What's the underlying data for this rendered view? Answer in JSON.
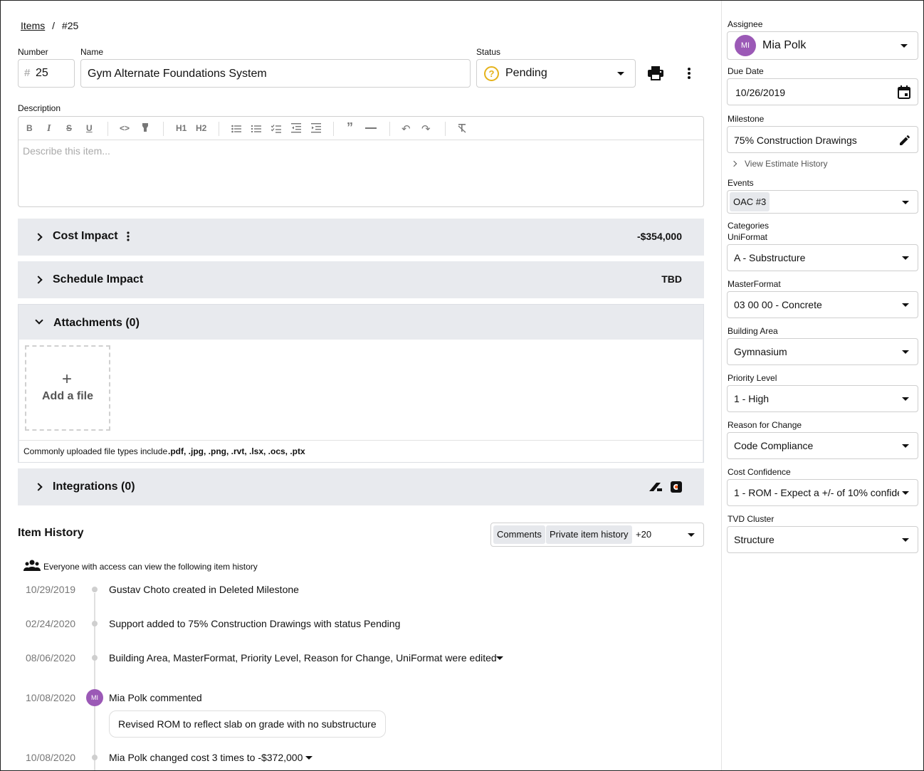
{
  "breadcrumb": {
    "root": "Items",
    "sep": "/",
    "current": "#25"
  },
  "fields": {
    "number_label": "Number",
    "number_prefix": "#",
    "number_value": "25",
    "name_label": "Name",
    "name_value": "Gym Alternate Foundations System",
    "status_label": "Status",
    "status_value": "Pending",
    "status_icon": "?",
    "description_label": "Description",
    "description_placeholder": "Describe this item..."
  },
  "toolbar": {
    "bold": "B",
    "italic": "I",
    "strike": "S",
    "underline": "U",
    "code": "<>",
    "highlight": "highlight-icon",
    "h1": "H1",
    "h2": "H2",
    "bullet": "bullet-list-icon",
    "numbered": "numbered-list-icon",
    "check": "check-list-icon",
    "outdent": "outdent-icon",
    "indent": "indent-icon",
    "quote": "quote-icon",
    "hr": "horizontal-rule-icon",
    "undo": "undo-icon",
    "redo": "redo-icon",
    "clear": "clear-format-icon"
  },
  "sections": {
    "cost_title": "Cost Impact",
    "cost_value": "-$354,000",
    "schedule_title": "Schedule Impact",
    "schedule_value": "TBD",
    "attachments_title": "Attachments (0)",
    "add_file_label": "Add a file",
    "file_types_prefix": "Commonly uploaded file types include",
    "file_types": ".pdf, .jpg, .png, .rvt, .lsx, .ocs, .ptx",
    "integrations_title": "Integrations (0)"
  },
  "history": {
    "title": "Item History",
    "filter_chips": [
      "Comments",
      "Private item history"
    ],
    "filter_more": "+20",
    "visibility_note": "Everyone with access can view the following item history",
    "entries": [
      {
        "date": "10/29/2019",
        "text": "Gustav Choto created in Deleted Milestone"
      },
      {
        "date": "02/24/2020",
        "text": "Support added to 75% Construction Drawings with status Pending"
      },
      {
        "date": "08/06/2020",
        "text": "Building Area, MasterFormat, Priority Level, Reason for Change, UniFormat were edited"
      },
      {
        "date": "10/08/2020",
        "text": "Mia Polk commented",
        "avatar": "MI",
        "comment": "Revised ROM to reflect slab on grade with no substructure"
      },
      {
        "date": "10/08/2020",
        "text": "Mia Polk changed cost 3 times to -$372,000"
      }
    ]
  },
  "sidebar": {
    "assignee_label": "Assignee",
    "assignee_initials": "MI",
    "assignee_name": "Mia Polk",
    "due_label": "Due Date",
    "due_value": "10/26/2019",
    "milestone_label": "Milestone",
    "milestone_value": "75% Construction Drawings",
    "view_history": "View Estimate History",
    "events_label": "Events",
    "events_chip": "OAC #3",
    "categories_label": "Categories",
    "uniformat_label": "UniFormat",
    "uniformat_value": "A - Substructure",
    "masterformat_label": "MasterFormat",
    "masterformat_value": "03 00 00 - Concrete",
    "building_label": "Building Area",
    "building_value": "Gymnasium",
    "priority_label": "Priority Level",
    "priority_value": "1 - High",
    "reason_label": "Reason for Change",
    "reason_value": "Code Compliance",
    "confidence_label": "Cost Confidence",
    "confidence_value": "1 - ROM - Expect a +/- of 10% confide...",
    "tvd_label": "TVD Cluster",
    "tvd_value": "Structure"
  },
  "colors": {
    "avatar": "#9b59b6",
    "status_icon": "#e5b21a",
    "section_bg": "#e8eaee",
    "border": "#cfcfcf"
  }
}
